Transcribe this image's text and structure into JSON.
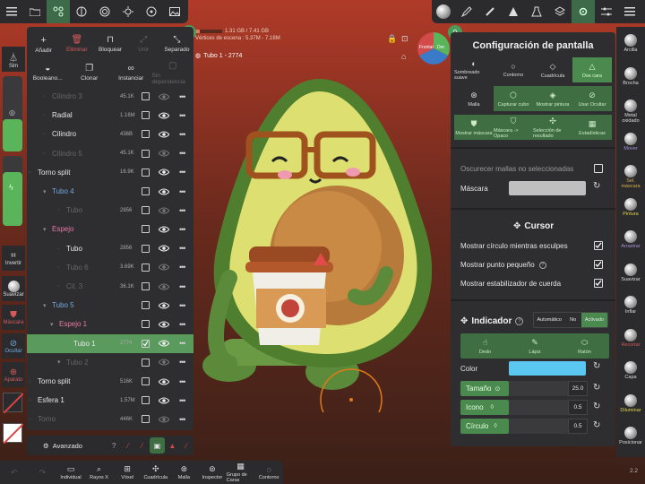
{
  "colors": {
    "accent_green": "#4a8a4e",
    "selection_green": "#5a9a5c",
    "mask_red": "#d45a5a",
    "pink": "#e87aa5",
    "blue": "#6fa8dc",
    "indicator_color": "#5ac8f0",
    "panel_bg": "#2e2e31"
  },
  "viewport": {
    "memory": "1.31 GB / 7.41 GB",
    "scene_vertices": "Vértices de escena : 5.37M - 7.18M",
    "mesh_name": "Tubo 1 - 2774",
    "gizmo_front": "Frontal",
    "gizmo_right": "Der.",
    "version": "2.2"
  },
  "left_strip": {
    "sym": "Sim",
    "invert": "Invertir",
    "smooth": "Suavizar",
    "mask": "Máscara",
    "hide": "Ocultar",
    "gizmo": "Aparato"
  },
  "scene_panel": {
    "row1": [
      "Añadir",
      "Eliminar",
      "Bloquear",
      "Unir",
      "Separado"
    ],
    "row2": [
      "Booleano...",
      "Clonar",
      "Instanciar",
      "Sin dependencia"
    ],
    "tree": [
      {
        "name": "Cilindro 3",
        "size": "45.1K",
        "faded": true,
        "icon": "sphere"
      },
      {
        "name": "Radial",
        "size": "1.16M",
        "icon": "sphere"
      },
      {
        "name": "Cilindro",
        "size": "436B",
        "icon": "sphere"
      },
      {
        "name": "Cilindro 5",
        "size": "45.1K",
        "faded": true,
        "icon": "sphere"
      },
      {
        "name": "Torno split",
        "size": "16.9K",
        "icon": "sphere"
      },
      {
        "name": "Tubo 4",
        "size": "",
        "color": "blue"
      },
      {
        "name": "Tubo",
        "size": "2856",
        "faded": true
      },
      {
        "name": "Espejo",
        "size": "",
        "color": "pink"
      },
      {
        "name": "Tubo",
        "size": "2856"
      },
      {
        "name": "Tubo 6",
        "size": "3.69K",
        "faded": true
      },
      {
        "name": "Cil. 3",
        "size": "36.1K",
        "faded": true
      },
      {
        "name": "Tubo 5",
        "size": "",
        "color": "blue"
      },
      {
        "name": "Espejo 1",
        "size": "",
        "color": "pink"
      },
      {
        "name": "Tubo 1",
        "size": "2774",
        "selected": true
      },
      {
        "name": "Tubo 2",
        "size": "",
        "faded": true
      },
      {
        "name": "Torno split",
        "size": "516K"
      },
      {
        "name": "Esfera 1",
        "size": "1.57M"
      },
      {
        "name": "Torno",
        "size": "446K",
        "faded": true
      }
    ],
    "footer": "Avanzado"
  },
  "bottom_bar": [
    "",
    "",
    "Individual",
    "Rayos X",
    "Vóxel",
    "Cuadrícula",
    "Malla",
    "Inspector",
    "Grupo de Caras",
    "Contorno"
  ],
  "right_strip": [
    "Arcilla",
    "Brocha",
    "Metal oxidado",
    "Mover",
    "Sel. máscara",
    "Pintura",
    "Arrastrar",
    "Suavizar",
    "Inflar",
    "Recortar",
    "Capa",
    "Diluminar",
    "Posicionar"
  ],
  "settings": {
    "title": "Configuración de pantalla",
    "row1": [
      "Sombreado suave",
      "Contorno",
      "Cuadrícula",
      "Dos cara"
    ],
    "row2": [
      "Malla",
      "Capturar cubo",
      "Mostrar pintura",
      "Usar Ocultar"
    ],
    "row3": [
      "Mostrar máscara",
      "Máscara -> Opaco",
      "Selección de resultado",
      "Estadísticas"
    ],
    "darken_unselected": "Oscurecer mallas no seleccionadas",
    "mask": "Máscara",
    "cursor_title": "Cursor",
    "cursor_opts": [
      "Mostrar círculo mientras esculpes",
      "Mostrar punto pequeño",
      "Mostrar estabilizador de cuerda"
    ],
    "indicator_title": "Indicador",
    "indicator_modes": [
      "Automático",
      "No",
      "Activado"
    ],
    "indicator_inputs": [
      "Dedo",
      "Lápiz",
      "Ratón"
    ],
    "color_label": "Color",
    "size_label": "Tamaño",
    "size_value": "25.0",
    "icon_label": "Icono",
    "icon_value": "0.5",
    "circle_label": "Círculo",
    "circle_value": "0.5"
  }
}
